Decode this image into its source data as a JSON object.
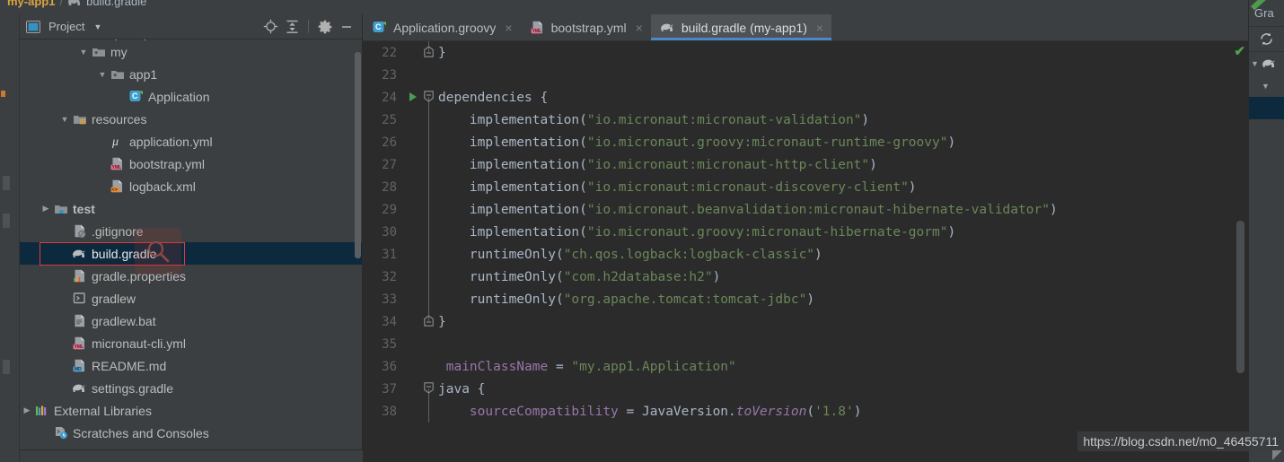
{
  "breadcrumb": {
    "project": "my-app1",
    "separator": "/",
    "file": "build.gradle",
    "file_icon": "gradle-elephant-icon"
  },
  "project_panel": {
    "title": "Project",
    "caret": "▼",
    "tools": [
      {
        "name": "locate-icon",
        "tooltip": "Select Opened File"
      },
      {
        "name": "collapse-all-icon",
        "tooltip": "Collapse All"
      },
      {
        "name": "gear-icon",
        "tooltip": "Settings"
      },
      {
        "name": "minimize-icon",
        "tooltip": "Hide"
      }
    ],
    "tree": [
      {
        "label": "groovy",
        "icon": "source-folder-icon",
        "twisty": "▼",
        "indent": 3,
        "clipped": true,
        "selected": false,
        "bold": false
      },
      {
        "label": "my",
        "icon": "package-folder-icon",
        "twisty": "▼",
        "indent": 3,
        "clipped": false,
        "selected": false,
        "bold": false
      },
      {
        "label": "app1",
        "icon": "package-folder-icon",
        "twisty": "▼",
        "indent": 4,
        "clipped": false,
        "selected": false,
        "bold": false
      },
      {
        "label": "Application",
        "icon": "groovy-class-icon",
        "twisty": "",
        "indent": 5,
        "clipped": false,
        "selected": false,
        "bold": false
      },
      {
        "label": "resources",
        "icon": "resources-folder-icon",
        "twisty": "▼",
        "indent": 2,
        "clipped": false,
        "selected": false,
        "bold": false
      },
      {
        "label": "application.yml",
        "icon": "micronaut-mu-icon",
        "twisty": "",
        "indent": 4,
        "clipped": false,
        "selected": false,
        "bold": false
      },
      {
        "label": "bootstrap.yml",
        "icon": "yml-file-icon",
        "twisty": "",
        "indent": 4,
        "clipped": false,
        "selected": false,
        "bold": false
      },
      {
        "label": "logback.xml",
        "icon": "xml-file-icon",
        "twisty": "",
        "indent": 4,
        "clipped": false,
        "selected": false,
        "bold": false
      },
      {
        "label": "test",
        "icon": "test-folder-icon",
        "twisty": "▶",
        "indent": 1,
        "clipped": false,
        "selected": false,
        "bold": true
      },
      {
        "label": ".gitignore",
        "icon": "gitignore-file-icon",
        "twisty": "",
        "indent": 2,
        "clipped": false,
        "selected": false,
        "bold": false
      },
      {
        "label": "build.gradle",
        "icon": "gradle-elephant-icon",
        "twisty": "",
        "indent": 2,
        "clipped": false,
        "selected": true,
        "bold": false
      },
      {
        "label": "gradle.properties",
        "icon": "properties-file-icon",
        "twisty": "",
        "indent": 2,
        "clipped": false,
        "selected": false,
        "bold": false
      },
      {
        "label": "gradlew",
        "icon": "shell-script-icon",
        "twisty": "",
        "indent": 2,
        "clipped": false,
        "selected": false,
        "bold": false
      },
      {
        "label": "gradlew.bat",
        "icon": "bat-file-icon",
        "twisty": "",
        "indent": 2,
        "clipped": false,
        "selected": false,
        "bold": false
      },
      {
        "label": "micronaut-cli.yml",
        "icon": "yml-file-icon",
        "twisty": "",
        "indent": 2,
        "clipped": false,
        "selected": false,
        "bold": false
      },
      {
        "label": "README.md",
        "icon": "markdown-file-icon",
        "twisty": "",
        "indent": 2,
        "clipped": false,
        "selected": false,
        "bold": false
      },
      {
        "label": "settings.gradle",
        "icon": "gradle-elephant-icon",
        "twisty": "",
        "indent": 2,
        "clipped": false,
        "selected": false,
        "bold": false
      },
      {
        "label": "External Libraries",
        "icon": "libraries-icon",
        "twisty": "▶",
        "indent": 0,
        "clipped": false,
        "selected": false,
        "bold": false
      },
      {
        "label": "Scratches and Consoles",
        "icon": "scratches-icon",
        "twisty": "",
        "indent": 1,
        "clipped": false,
        "selected": false,
        "bold": false
      }
    ]
  },
  "editor": {
    "tabs": [
      {
        "label": "Application.groovy",
        "icon": "groovy-class-icon",
        "active": false,
        "close": "×"
      },
      {
        "label": "bootstrap.yml",
        "icon": "yml-file-icon",
        "active": false,
        "close": "×"
      },
      {
        "label": "build.gradle (my-app1)",
        "icon": "gradle-elephant-icon",
        "active": true,
        "close": "×"
      }
    ],
    "inspection_status": "✔",
    "lines": [
      {
        "no": "22",
        "indent": 0,
        "fold": "close",
        "run": false,
        "tokens": [
          {
            "t": "}",
            "c": "pl"
          }
        ]
      },
      {
        "no": "23",
        "indent": 0,
        "fold": "",
        "run": false,
        "tokens": []
      },
      {
        "no": "24",
        "indent": 0,
        "fold": "open",
        "run": true,
        "tokens": [
          {
            "t": "dependencies {",
            "c": "pl"
          }
        ]
      },
      {
        "no": "25",
        "indent": 1,
        "fold": "bar",
        "run": false,
        "tokens": [
          {
            "t": "implementation(",
            "c": "fn"
          },
          {
            "t": "\"io.micronaut:micronaut-validation\"",
            "c": "s"
          },
          {
            "t": ")",
            "c": "fn"
          }
        ]
      },
      {
        "no": "26",
        "indent": 1,
        "fold": "bar",
        "run": false,
        "tokens": [
          {
            "t": "implementation(",
            "c": "fn"
          },
          {
            "t": "\"io.micronaut.groovy:micronaut-runtime-groovy\"",
            "c": "s"
          },
          {
            "t": ")",
            "c": "fn"
          }
        ]
      },
      {
        "no": "27",
        "indent": 1,
        "fold": "bar",
        "run": false,
        "tokens": [
          {
            "t": "implementation(",
            "c": "fn"
          },
          {
            "t": "\"io.micronaut:micronaut-http-client\"",
            "c": "s"
          },
          {
            "t": ")",
            "c": "fn"
          }
        ]
      },
      {
        "no": "28",
        "indent": 1,
        "fold": "bar",
        "run": false,
        "tokens": [
          {
            "t": "implementation(",
            "c": "fn"
          },
          {
            "t": "\"io.micronaut:micronaut-discovery-client\"",
            "c": "s"
          },
          {
            "t": ")",
            "c": "fn"
          }
        ]
      },
      {
        "no": "29",
        "indent": 1,
        "fold": "bar",
        "run": false,
        "tokens": [
          {
            "t": "implementation(",
            "c": "fn"
          },
          {
            "t": "\"io.micronaut.beanvalidation:micronaut-hibernate-validator\"",
            "c": "s"
          },
          {
            "t": ")",
            "c": "fn"
          }
        ]
      },
      {
        "no": "30",
        "indent": 1,
        "fold": "bar",
        "run": false,
        "tokens": [
          {
            "t": "implementation(",
            "c": "fn"
          },
          {
            "t": "\"io.micronaut.groovy:micronaut-hibernate-gorm\"",
            "c": "s"
          },
          {
            "t": ")",
            "c": "fn"
          }
        ]
      },
      {
        "no": "31",
        "indent": 1,
        "fold": "bar",
        "run": false,
        "tokens": [
          {
            "t": "runtimeOnly(",
            "c": "fn"
          },
          {
            "t": "\"ch.qos.logback:logback-classic\"",
            "c": "s"
          },
          {
            "t": ")",
            "c": "fn"
          }
        ]
      },
      {
        "no": "32",
        "indent": 1,
        "fold": "bar",
        "run": false,
        "tokens": [
          {
            "t": "runtimeOnly(",
            "c": "fn"
          },
          {
            "t": "\"com.h2database:h2\"",
            "c": "s"
          },
          {
            "t": ")",
            "c": "fn"
          }
        ]
      },
      {
        "no": "33",
        "indent": 1,
        "fold": "bar",
        "run": false,
        "tokens": [
          {
            "t": "runtimeOnly(",
            "c": "fn"
          },
          {
            "t": "\"org.apache.tomcat:tomcat-jdbc\"",
            "c": "s"
          },
          {
            "t": ")",
            "c": "fn"
          }
        ]
      },
      {
        "no": "34",
        "indent": 0,
        "fold": "close",
        "run": false,
        "tokens": [
          {
            "t": "}",
            "c": "pl"
          }
        ]
      },
      {
        "no": "35",
        "indent": 0,
        "fold": "",
        "run": false,
        "tokens": []
      },
      {
        "no": "36",
        "indent": 0,
        "fold": "",
        "run": false,
        "tokens": [
          {
            "t": " mainClassName ",
            "c": "pr"
          },
          {
            "t": "= ",
            "c": "pl"
          },
          {
            "t": "\"my.app1.Application\"",
            "c": "s"
          }
        ]
      },
      {
        "no": "37",
        "indent": 0,
        "fold": "open",
        "run": false,
        "tokens": [
          {
            "t": "java {",
            "c": "pl"
          }
        ]
      },
      {
        "no": "38",
        "indent": 1,
        "fold": "bar",
        "run": false,
        "tokens": [
          {
            "t": "sourceCompatibility ",
            "c": "pr"
          },
          {
            "t": "= ",
            "c": "pl"
          },
          {
            "t": "JavaVersion.",
            "c": "pl"
          },
          {
            "t": "toVersion",
            "c": "it"
          },
          {
            "t": "(",
            "c": "pl"
          },
          {
            "t": "'1.8'",
            "c": "s"
          },
          {
            "t": ")",
            "c": "pl"
          }
        ]
      }
    ]
  },
  "gradle_panel": {
    "title": "Gra",
    "refresh_icon": "refresh-icon",
    "rows": [
      {
        "twisty": "▼",
        "icon": "gradle-elephant-icon",
        "label": "",
        "selected": false
      },
      {
        "twisty": "▼",
        "icon": "",
        "label": "",
        "selected": false
      },
      {
        "twisty": "",
        "icon": "",
        "label": "",
        "selected": true
      }
    ]
  },
  "watermark": {
    "url": "https://blog.csdn.net/m0_46455711",
    "magnifier_icon": "magnifier-icon"
  },
  "colors": {
    "panel_bg": "#3c3f41",
    "editor_bg": "#2b2b2b",
    "selection": "#0d293e",
    "accent_tab_underline": "#4a88c7",
    "string_green": "#6a8759",
    "keyword_orange": "#cc7832",
    "property_purple": "#9876aa",
    "text": "#a9b7c6",
    "highlight_box": "#e03a3a",
    "run_green": "#499c54"
  }
}
